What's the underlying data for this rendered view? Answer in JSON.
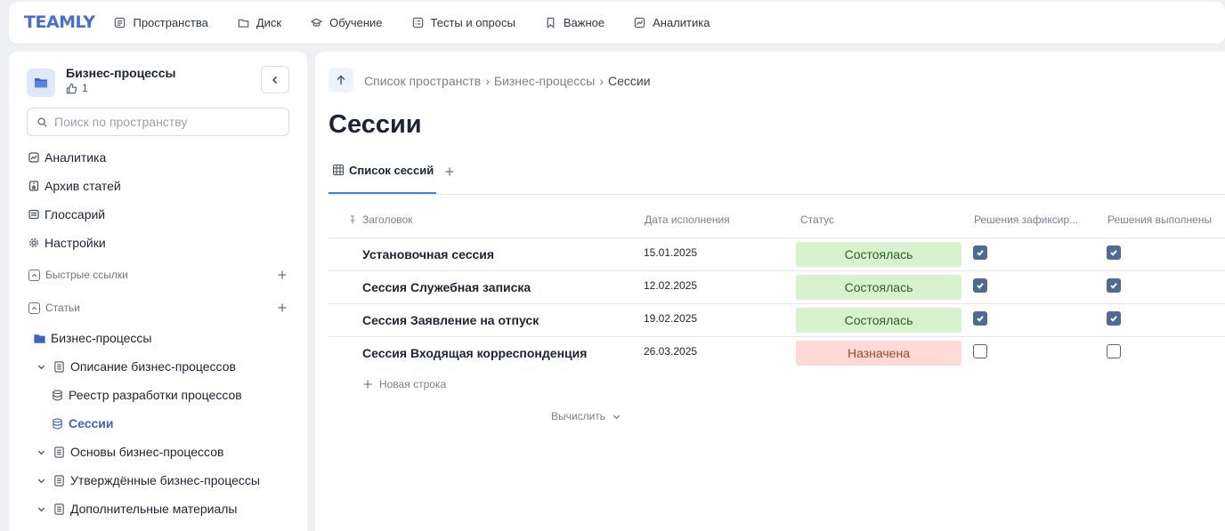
{
  "topbar": {
    "logo": "TEAMLY",
    "nav": [
      {
        "label": "Пространства",
        "icon": "spaces-icon"
      },
      {
        "label": "Диск",
        "icon": "folder-icon"
      },
      {
        "label": "Обучение",
        "icon": "graduation-icon"
      },
      {
        "label": "Тесты и опросы",
        "icon": "checklist-icon"
      },
      {
        "label": "Важное",
        "icon": "bookmark-icon"
      },
      {
        "label": "Аналитика",
        "icon": "analytics-icon"
      }
    ]
  },
  "sidebar": {
    "space_title": "Бизнес-процессы",
    "likes": "1",
    "search_placeholder": "Поиск по пространству",
    "menu": [
      {
        "label": "Аналитика",
        "icon": "analytics-icon"
      },
      {
        "label": "Архив статей",
        "icon": "archive-icon"
      },
      {
        "label": "Глоссарий",
        "icon": "glossary-icon"
      },
      {
        "label": "Настройки",
        "icon": "gear-icon"
      }
    ],
    "sections": {
      "quick_links": "Быстрые ссылки",
      "articles": "Статьи"
    },
    "tree": [
      {
        "label": "Бизнес-процессы",
        "icon": "folder-icon",
        "level": 0,
        "chevron": false,
        "active": false
      },
      {
        "label": "Описание бизнес-процессов",
        "icon": "page-icon",
        "level": 1,
        "chevron": true,
        "active": false
      },
      {
        "label": "Реестр разработки процессов",
        "icon": "database-icon",
        "level": 2,
        "chevron": false,
        "active": false
      },
      {
        "label": "Сессии",
        "icon": "database-icon",
        "level": 2,
        "chevron": false,
        "active": true
      },
      {
        "label": "Основы бизнес-процессов",
        "icon": "page-icon",
        "level": 1,
        "chevron": true,
        "active": false
      },
      {
        "label": "Утверждённые бизнес-процессы",
        "icon": "page-icon",
        "level": 1,
        "chevron": true,
        "active": false
      },
      {
        "label": "Дополнительные материалы",
        "icon": "page-icon",
        "level": 1,
        "chevron": true,
        "active": false
      }
    ]
  },
  "main": {
    "breadcrumb": [
      "Список пространств",
      "Бизнес-процессы",
      "Сессии"
    ],
    "title": "Сессии",
    "tab": "Список сессий",
    "columns": [
      "Заголовок",
      "Дата исполнения",
      "Статус",
      "Решения зафиксир...",
      "Решения выполнены"
    ],
    "rows": [
      {
        "title": "Установочная сессия",
        "date": "15.01.2025",
        "status": "Состоялась",
        "status_kind": "done",
        "fixed": true,
        "done": true
      },
      {
        "title": "Сессия Служебная записка",
        "date": "12.02.2025",
        "status": "Состоялась",
        "status_kind": "done",
        "fixed": true,
        "done": true
      },
      {
        "title": "Сессия Заявление на отпуск",
        "date": "19.02.2025",
        "status": "Состоялась",
        "status_kind": "done",
        "fixed": true,
        "done": true
      },
      {
        "title": "Сессия Входящая корреспонденция",
        "date": "26.03.2025",
        "status": "Назначена",
        "status_kind": "assigned",
        "fixed": false,
        "done": false
      }
    ],
    "new_row": "Новая строка",
    "calculate": "Вычислить"
  },
  "colors": {
    "accent": "#3b64c2",
    "status_done_bg": "#d8f1cf",
    "status_assigned_bg": "#fddad6",
    "checkbox_on": "#4e6a95"
  }
}
